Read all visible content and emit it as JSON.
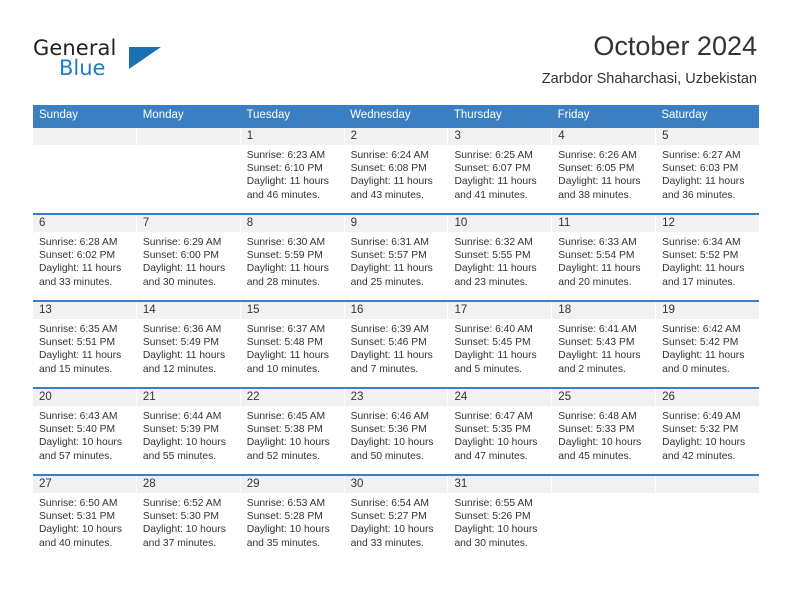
{
  "brand": {
    "name_part1": "General",
    "name_part2": "Blue",
    "logo_icon": "triangle-logo-icon"
  },
  "header": {
    "title": "October 2024",
    "subtitle": "Zarbdor Shaharchasi, Uzbekistan"
  },
  "weekdays": [
    "Sunday",
    "Monday",
    "Tuesday",
    "Wednesday",
    "Thursday",
    "Friday",
    "Saturday"
  ],
  "colors": {
    "header_blue": "#3a7fc1",
    "daynum_gray": "#f1f1f1",
    "text": "#333333",
    "brand_blue": "#1f7dc2"
  },
  "weeks": [
    [
      {
        "day": "",
        "sunrise": "",
        "sunset": "",
        "daylight_line1": "",
        "daylight_line2": ""
      },
      {
        "day": "",
        "sunrise": "",
        "sunset": "",
        "daylight_line1": "",
        "daylight_line2": ""
      },
      {
        "day": "1",
        "sunrise": "Sunrise: 6:23 AM",
        "sunset": "Sunset: 6:10 PM",
        "daylight_line1": "Daylight: 11 hours",
        "daylight_line2": "and 46 minutes."
      },
      {
        "day": "2",
        "sunrise": "Sunrise: 6:24 AM",
        "sunset": "Sunset: 6:08 PM",
        "daylight_line1": "Daylight: 11 hours",
        "daylight_line2": "and 43 minutes."
      },
      {
        "day": "3",
        "sunrise": "Sunrise: 6:25 AM",
        "sunset": "Sunset: 6:07 PM",
        "daylight_line1": "Daylight: 11 hours",
        "daylight_line2": "and 41 minutes."
      },
      {
        "day": "4",
        "sunrise": "Sunrise: 6:26 AM",
        "sunset": "Sunset: 6:05 PM",
        "daylight_line1": "Daylight: 11 hours",
        "daylight_line2": "and 38 minutes."
      },
      {
        "day": "5",
        "sunrise": "Sunrise: 6:27 AM",
        "sunset": "Sunset: 6:03 PM",
        "daylight_line1": "Daylight: 11 hours",
        "daylight_line2": "and 36 minutes."
      }
    ],
    [
      {
        "day": "6",
        "sunrise": "Sunrise: 6:28 AM",
        "sunset": "Sunset: 6:02 PM",
        "daylight_line1": "Daylight: 11 hours",
        "daylight_line2": "and 33 minutes."
      },
      {
        "day": "7",
        "sunrise": "Sunrise: 6:29 AM",
        "sunset": "Sunset: 6:00 PM",
        "daylight_line1": "Daylight: 11 hours",
        "daylight_line2": "and 30 minutes."
      },
      {
        "day": "8",
        "sunrise": "Sunrise: 6:30 AM",
        "sunset": "Sunset: 5:59 PM",
        "daylight_line1": "Daylight: 11 hours",
        "daylight_line2": "and 28 minutes."
      },
      {
        "day": "9",
        "sunrise": "Sunrise: 6:31 AM",
        "sunset": "Sunset: 5:57 PM",
        "daylight_line1": "Daylight: 11 hours",
        "daylight_line2": "and 25 minutes."
      },
      {
        "day": "10",
        "sunrise": "Sunrise: 6:32 AM",
        "sunset": "Sunset: 5:55 PM",
        "daylight_line1": "Daylight: 11 hours",
        "daylight_line2": "and 23 minutes."
      },
      {
        "day": "11",
        "sunrise": "Sunrise: 6:33 AM",
        "sunset": "Sunset: 5:54 PM",
        "daylight_line1": "Daylight: 11 hours",
        "daylight_line2": "and 20 minutes."
      },
      {
        "day": "12",
        "sunrise": "Sunrise: 6:34 AM",
        "sunset": "Sunset: 5:52 PM",
        "daylight_line1": "Daylight: 11 hours",
        "daylight_line2": "and 17 minutes."
      }
    ],
    [
      {
        "day": "13",
        "sunrise": "Sunrise: 6:35 AM",
        "sunset": "Sunset: 5:51 PM",
        "daylight_line1": "Daylight: 11 hours",
        "daylight_line2": "and 15 minutes."
      },
      {
        "day": "14",
        "sunrise": "Sunrise: 6:36 AM",
        "sunset": "Sunset: 5:49 PM",
        "daylight_line1": "Daylight: 11 hours",
        "daylight_line2": "and 12 minutes."
      },
      {
        "day": "15",
        "sunrise": "Sunrise: 6:37 AM",
        "sunset": "Sunset: 5:48 PM",
        "daylight_line1": "Daylight: 11 hours",
        "daylight_line2": "and 10 minutes."
      },
      {
        "day": "16",
        "sunrise": "Sunrise: 6:39 AM",
        "sunset": "Sunset: 5:46 PM",
        "daylight_line1": "Daylight: 11 hours",
        "daylight_line2": "and 7 minutes."
      },
      {
        "day": "17",
        "sunrise": "Sunrise: 6:40 AM",
        "sunset": "Sunset: 5:45 PM",
        "daylight_line1": "Daylight: 11 hours",
        "daylight_line2": "and 5 minutes."
      },
      {
        "day": "18",
        "sunrise": "Sunrise: 6:41 AM",
        "sunset": "Sunset: 5:43 PM",
        "daylight_line1": "Daylight: 11 hours",
        "daylight_line2": "and 2 minutes."
      },
      {
        "day": "19",
        "sunrise": "Sunrise: 6:42 AM",
        "sunset": "Sunset: 5:42 PM",
        "daylight_line1": "Daylight: 11 hours",
        "daylight_line2": "and 0 minutes."
      }
    ],
    [
      {
        "day": "20",
        "sunrise": "Sunrise: 6:43 AM",
        "sunset": "Sunset: 5:40 PM",
        "daylight_line1": "Daylight: 10 hours",
        "daylight_line2": "and 57 minutes."
      },
      {
        "day": "21",
        "sunrise": "Sunrise: 6:44 AM",
        "sunset": "Sunset: 5:39 PM",
        "daylight_line1": "Daylight: 10 hours",
        "daylight_line2": "and 55 minutes."
      },
      {
        "day": "22",
        "sunrise": "Sunrise: 6:45 AM",
        "sunset": "Sunset: 5:38 PM",
        "daylight_line1": "Daylight: 10 hours",
        "daylight_line2": "and 52 minutes."
      },
      {
        "day": "23",
        "sunrise": "Sunrise: 6:46 AM",
        "sunset": "Sunset: 5:36 PM",
        "daylight_line1": "Daylight: 10 hours",
        "daylight_line2": "and 50 minutes."
      },
      {
        "day": "24",
        "sunrise": "Sunrise: 6:47 AM",
        "sunset": "Sunset: 5:35 PM",
        "daylight_line1": "Daylight: 10 hours",
        "daylight_line2": "and 47 minutes."
      },
      {
        "day": "25",
        "sunrise": "Sunrise: 6:48 AM",
        "sunset": "Sunset: 5:33 PM",
        "daylight_line1": "Daylight: 10 hours",
        "daylight_line2": "and 45 minutes."
      },
      {
        "day": "26",
        "sunrise": "Sunrise: 6:49 AM",
        "sunset": "Sunset: 5:32 PM",
        "daylight_line1": "Daylight: 10 hours",
        "daylight_line2": "and 42 minutes."
      }
    ],
    [
      {
        "day": "27",
        "sunrise": "Sunrise: 6:50 AM",
        "sunset": "Sunset: 5:31 PM",
        "daylight_line1": "Daylight: 10 hours",
        "daylight_line2": "and 40 minutes."
      },
      {
        "day": "28",
        "sunrise": "Sunrise: 6:52 AM",
        "sunset": "Sunset: 5:30 PM",
        "daylight_line1": "Daylight: 10 hours",
        "daylight_line2": "and 37 minutes."
      },
      {
        "day": "29",
        "sunrise": "Sunrise: 6:53 AM",
        "sunset": "Sunset: 5:28 PM",
        "daylight_line1": "Daylight: 10 hours",
        "daylight_line2": "and 35 minutes."
      },
      {
        "day": "30",
        "sunrise": "Sunrise: 6:54 AM",
        "sunset": "Sunset: 5:27 PM",
        "daylight_line1": "Daylight: 10 hours",
        "daylight_line2": "and 33 minutes."
      },
      {
        "day": "31",
        "sunrise": "Sunrise: 6:55 AM",
        "sunset": "Sunset: 5:26 PM",
        "daylight_line1": "Daylight: 10 hours",
        "daylight_line2": "and 30 minutes."
      },
      {
        "day": "",
        "sunrise": "",
        "sunset": "",
        "daylight_line1": "",
        "daylight_line2": ""
      },
      {
        "day": "",
        "sunrise": "",
        "sunset": "",
        "daylight_line1": "",
        "daylight_line2": ""
      }
    ]
  ]
}
